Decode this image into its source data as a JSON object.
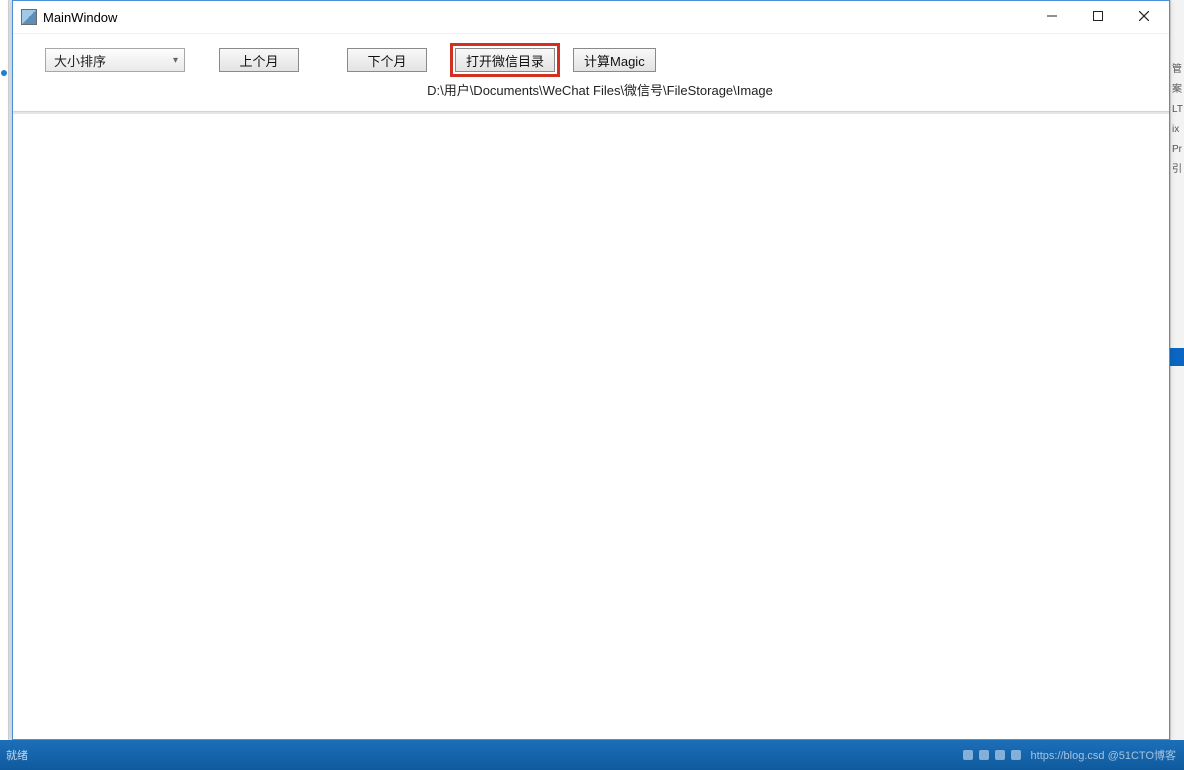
{
  "window": {
    "title": "MainWindow"
  },
  "toolbar": {
    "sort_combo": {
      "selected": "大小排序"
    },
    "prev_month_label": "上个月",
    "next_month_label": "下个月",
    "open_wechat_dir_label": "打开微信目录",
    "calc_magic_label": "计算Magic"
  },
  "path_line": "D:\\用户\\Documents\\WeChat Files\\微信号\\FileStorage\\Image",
  "background_hints": [
    "管",
    "",
    "案",
    "LT",
    "ix",
    "Pr",
    "",
    "",
    "引"
  ],
  "taskbar": {
    "left_text": "就绪",
    "right_text": "https://blog.csd   @51CTO博客"
  },
  "watermark": ""
}
